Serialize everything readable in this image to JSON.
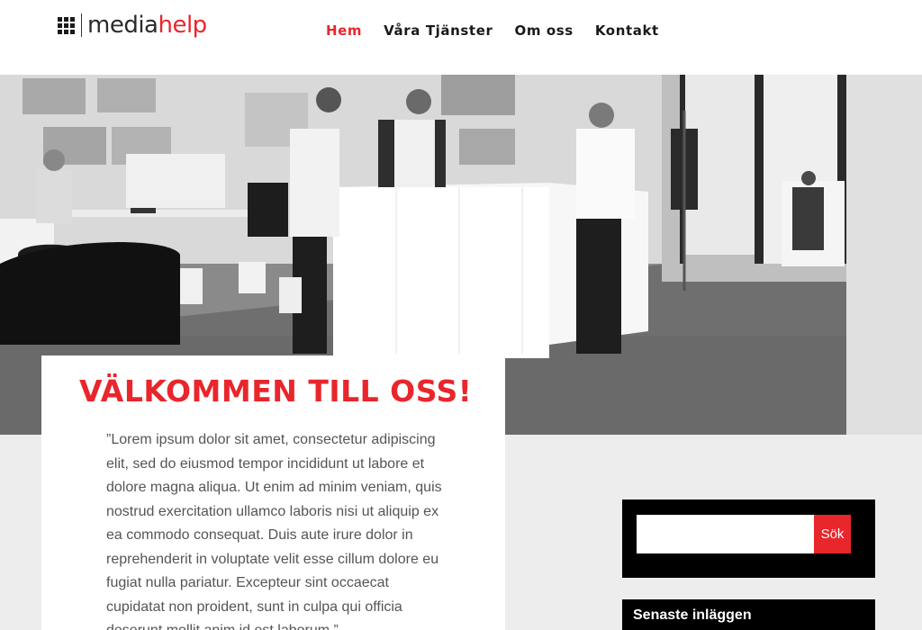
{
  "brand": {
    "logo_text_dark": "media",
    "logo_text_accent": "help",
    "accent_color": "#e8262c",
    "logo_icon": "grid-icon"
  },
  "nav": {
    "items": [
      {
        "label": "Hem",
        "active": true
      },
      {
        "label": "Våra Tjänster",
        "active": false
      },
      {
        "label": "Om oss",
        "active": false
      },
      {
        "label": "Kontakt",
        "active": false
      }
    ]
  },
  "hero": {
    "image": "office-photo-grayscale"
  },
  "welcome": {
    "title": "VÄLKOMMEN TILL OSS!",
    "text": "”Lorem ipsum dolor sit amet, consectetur adipiscing elit, sed do eiusmod tempor incididunt ut labore et dolore magna aliqua. Ut enim ad minim veniam, quis nostrud exercitation ullamco laboris nisi ut aliquip ex ea commodo consequat. Duis aute irure dolor in reprehenderit in voluptate velit esse cillum dolore eu fugiat nulla pariatur. Excepteur sint occaecat cupidatat non proident, sunt in culpa qui officia deserunt mollit anim id est laborum.”"
  },
  "sidebar": {
    "search": {
      "value": "",
      "placeholder": "",
      "button_label": "Sök"
    },
    "recent_posts": {
      "title": "Senaste inläggen"
    }
  }
}
